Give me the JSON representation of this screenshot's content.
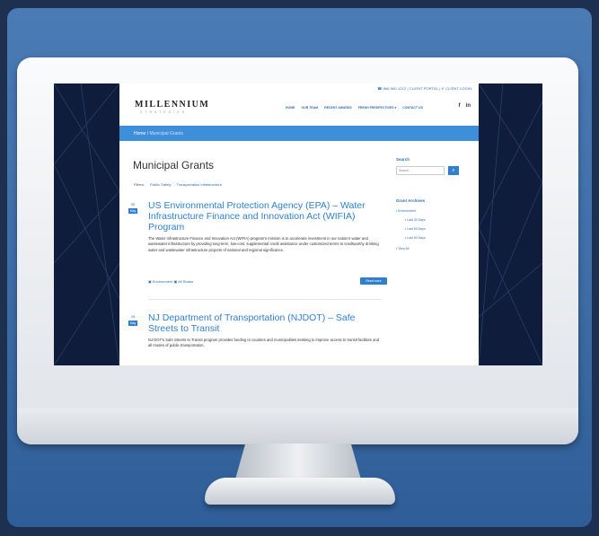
{
  "site": {
    "utility_links": "☎ 866.960.1212  |  CLIENT PORTAL  |  ✔ CLIENT LOGIN",
    "logo": "MILLENNIUM",
    "logo_sub": "STRATEGIES",
    "nav": [
      "HOME",
      "OUR TEAM",
      "RECENT AWARDS",
      "FRESH PERSPECTIVES ▾",
      "CONTACT US"
    ],
    "social": [
      "f",
      "in"
    ],
    "breadcrumb": {
      "home": "Home",
      "separator": " / ",
      "current": "Municipal Grants"
    },
    "page_title": "Municipal Grants",
    "filters": {
      "label": "Filters:",
      "items": [
        "Public Safety",
        "Transportation Infrastructure"
      ]
    },
    "posts": [
      {
        "day": "30",
        "month": "May",
        "title": "US Environmental Protection Agency (EPA) – Water Infrastructure Finance and Innovation Act (WIFIA) Program",
        "excerpt": "The Water Infrastructure Finance and Innovation Act (WIFIA) program's mission is to accelerate investment in our nation's water and wastewater infrastructure by providing long-term, low-cost, supplemental credit assistance under customized terms to creditworthy drinking water and wastewater infrastructure projects of national and regional significance.",
        "meta": "▣ Environment   ▣ All States",
        "read_more": "Read more"
      },
      {
        "day": "29",
        "month": "May",
        "title": "NJ Department of Transportation (NJDOT) – Safe Streets to Transit",
        "excerpt": "NJ DOT's Safe Streets to Transit program provides funding to counties and municipalities seeking to improve access to transit facilities and all modes of public transportation.",
        "meta": "",
        "read_more": ""
      }
    ],
    "sidebar": {
      "search_heading": "Search",
      "search_placeholder": "Search...",
      "search_button": "⌕",
      "archives_heading": "Grant Archives",
      "archives": [
        "• Environment",
        "• Last 30 Days",
        "• Last 60 Days",
        "• Last 90 Days",
        "• View All"
      ]
    }
  },
  "colors": {
    "background": "#1d3050",
    "card": "#3f6fa8",
    "accent": "#2f7fd0",
    "screen_dark": "#0f1c3b"
  }
}
